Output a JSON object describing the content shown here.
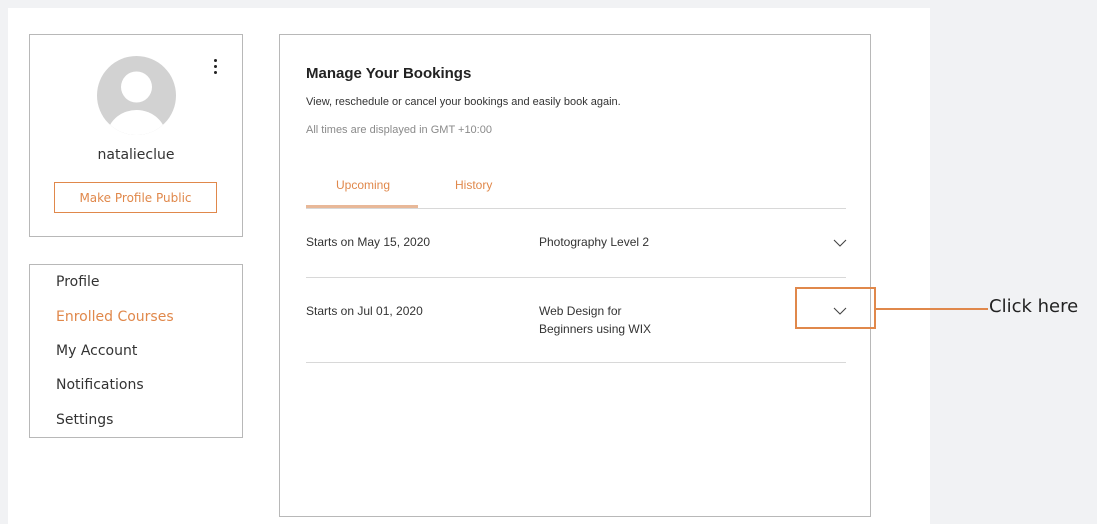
{
  "profile": {
    "username": "natalieclue",
    "make_public_label": "Make Profile Public",
    "avatar_icon": "user-avatar-icon",
    "menu_icon": "more-vertical-icon"
  },
  "menu": {
    "items": [
      {
        "label": "Profile",
        "active": false
      },
      {
        "label": "Enrolled Courses",
        "active": true
      },
      {
        "label": "My Account",
        "active": false
      },
      {
        "label": "Notifications",
        "active": false
      },
      {
        "label": "Settings",
        "active": false
      }
    ]
  },
  "bookings": {
    "title": "Manage Your Bookings",
    "subtitle": "View, reschedule or cancel your bookings and easily book again.",
    "timezone_note": "All times are displayed in GMT +10:00",
    "tabs": [
      {
        "label": "Upcoming",
        "active": true
      },
      {
        "label": "History",
        "active": false
      }
    ],
    "rows": [
      {
        "start": "Starts on May 15, 2020",
        "course_line1": "Photography Level 2",
        "course_line2": ""
      },
      {
        "start": "Starts on Jul 01, 2020",
        "course_line1": "Web Design for",
        "course_line2": "Beginners using WIX"
      }
    ],
    "expand_icon": "chevron-down-icon"
  },
  "annotation": {
    "callout_text": "Click here"
  },
  "colors": {
    "accent": "#e0884b",
    "tab_underline": "#e8b898",
    "background": "#f1f2f4",
    "border": "#b8b8b8"
  }
}
